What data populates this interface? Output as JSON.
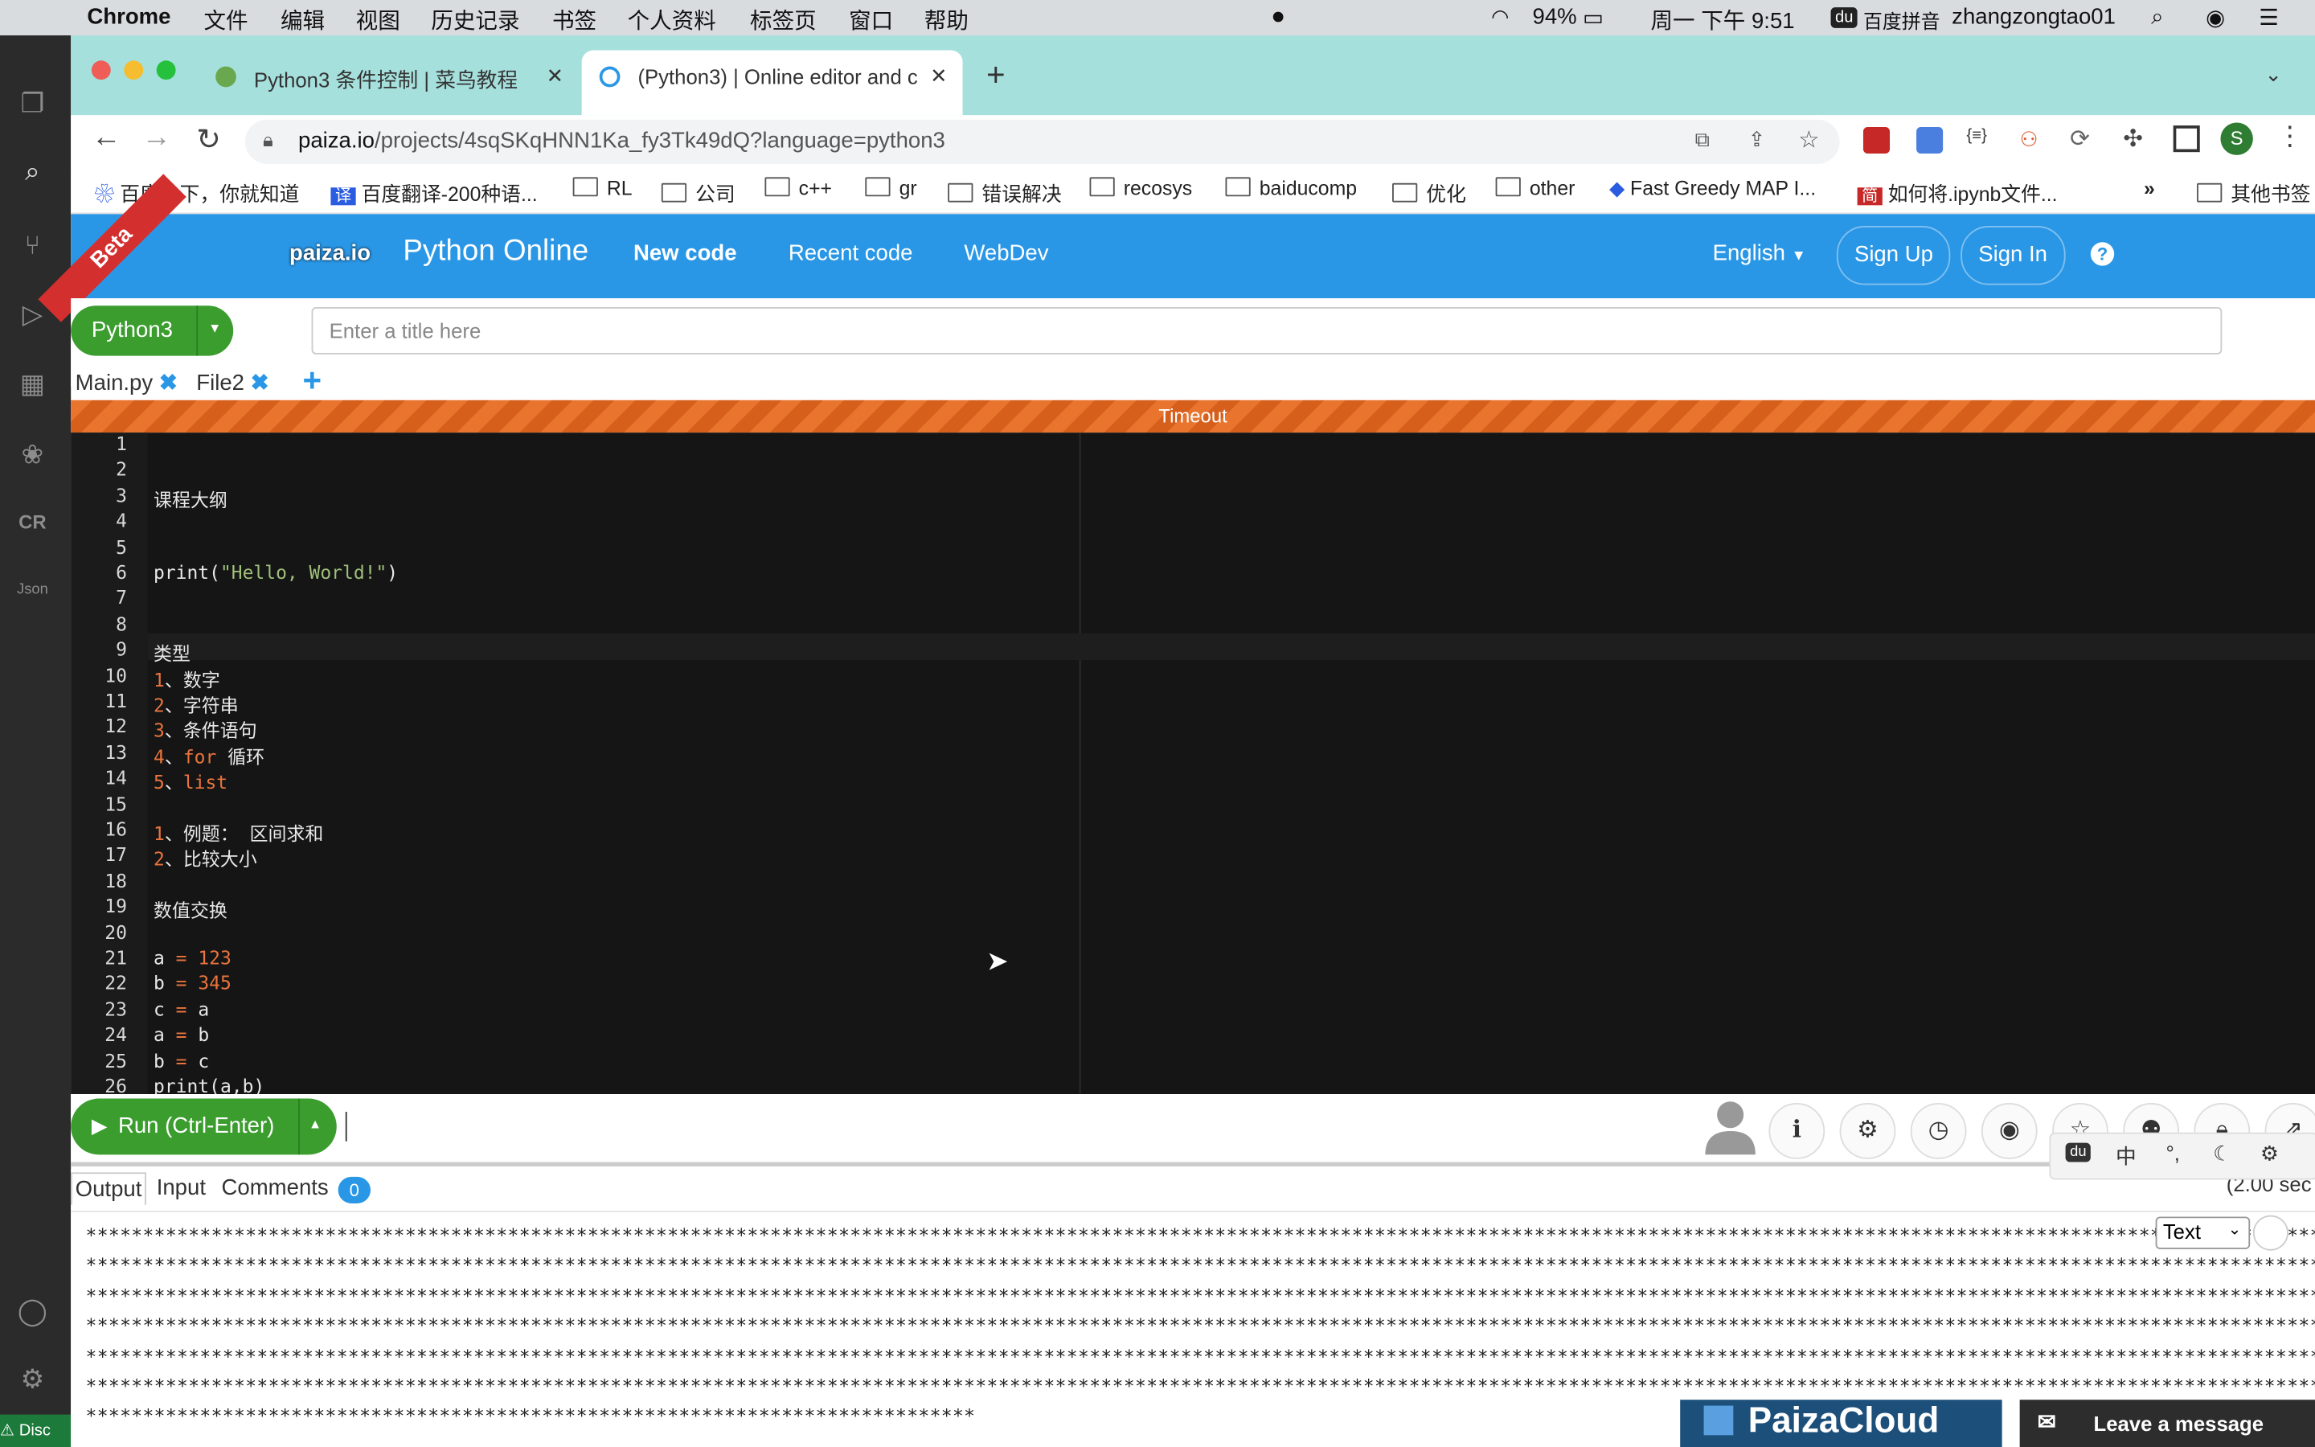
{
  "menubar": {
    "app": "Chrome",
    "items": [
      "文件",
      "编辑",
      "视图",
      "历史记录",
      "书签",
      "个人资料",
      "标签页",
      "窗口",
      "帮助"
    ],
    "battery": "94%",
    "datetime": "周一 下午 9:51",
    "ime": "百度拼音",
    "user": "zhangzongtao01"
  },
  "tabs": [
    {
      "title": "Python3 条件控制 | 菜鸟教程"
    },
    {
      "title": "(Python3) | Online editor and c"
    }
  ],
  "address": {
    "host": "paiza.io",
    "path": "/projects/4sqSKqHNN1Ka_fy3Tk49dQ?language=python3",
    "profile_initial": "S"
  },
  "bookmarks": [
    "百度一下，你就知道",
    "百度翻译-200种语...",
    "RL",
    "公司",
    "c++",
    "gr",
    "错误解决",
    "recosys",
    "baiducomp",
    "优化",
    "other",
    "Fast Greedy MAP I...",
    "如何将.ipynb文件...",
    "»",
    "其他书签"
  ],
  "paiza": {
    "beta": "Beta",
    "logo": "paiza.io",
    "product": "Python Online",
    "nav": [
      "New code",
      "Recent code",
      "WebDev"
    ],
    "language_menu": "English",
    "sign_up": "Sign Up",
    "sign_in": "Sign In",
    "help": "?",
    "lang_button": "Python3",
    "title_placeholder": "Enter a title here",
    "files": [
      "Main.py",
      "File2"
    ],
    "add_file": "+",
    "timeout": "Timeout"
  },
  "code_lines": [
    "",
    "",
    "课程大纲",
    "",
    "",
    "print(\"Hello, World!\")",
    "",
    "",
    "类型",
    "1、数字",
    "2、字符串",
    "3、条件语句",
    "4、for 循环",
    "5、list",
    "",
    "1、例题： 区间求和",
    "2、比较大小",
    "",
    "数值交换",
    "",
    "a = 123",
    "b = 345",
    "c = a",
    "a = b",
    "b = c",
    "print(a,b)"
  ],
  "run": {
    "label": "Run (Ctrl-Enter)"
  },
  "output_tabs": {
    "output": "Output",
    "input": "Input",
    "comments": "Comments",
    "comments_count": "0",
    "elapsed": "(2.00 sec"
  },
  "output_format": "Text",
  "ime_bar": [
    "du",
    "中",
    "°,",
    "☾",
    "⚙"
  ],
  "footer": {
    "cloud": "PaizaCloud",
    "message": "Leave a message",
    "disc": "⚠ Disc"
  }
}
